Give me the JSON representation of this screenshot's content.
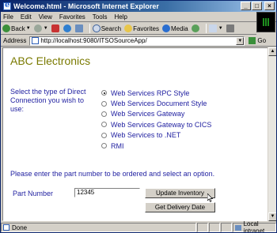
{
  "window": {
    "title": "Welcome.html - Microsoft Internet Explorer"
  },
  "title_buttons": {
    "minimize": "_",
    "maximize": "□",
    "close": "×"
  },
  "menu": [
    "File",
    "Edit",
    "View",
    "Favorites",
    "Tools",
    "Help"
  ],
  "toolbar": {
    "back": "Back",
    "search": "Search",
    "favorites": "Favorites",
    "media": "Media"
  },
  "address": {
    "label": "Address",
    "url": "http://localhost:9080/ITSOSourceApp/",
    "go": "Go"
  },
  "page": {
    "title": "ABC Electronics",
    "prompt": "Select the type of Direct Connection you wish to use:",
    "options": [
      {
        "label": "Web Services RPC Style",
        "checked": true
      },
      {
        "label": "Web Services Document Style",
        "checked": false
      },
      {
        "label": "Web Services Gateway",
        "checked": false
      },
      {
        "label": "Web Services Gateway to CICS",
        "checked": false
      },
      {
        "label": "Web Services to .NET",
        "checked": false
      },
      {
        "label": "RMI",
        "checked": false
      }
    ],
    "instruction": "Please enter the part number to be ordered and select an option.",
    "part_label": "Part Number",
    "part_value": "12345",
    "update_button": "Update Inventory",
    "delivery_button": "Get Delivery Date"
  },
  "status": {
    "left": "Done",
    "zone": "Local intranet"
  }
}
